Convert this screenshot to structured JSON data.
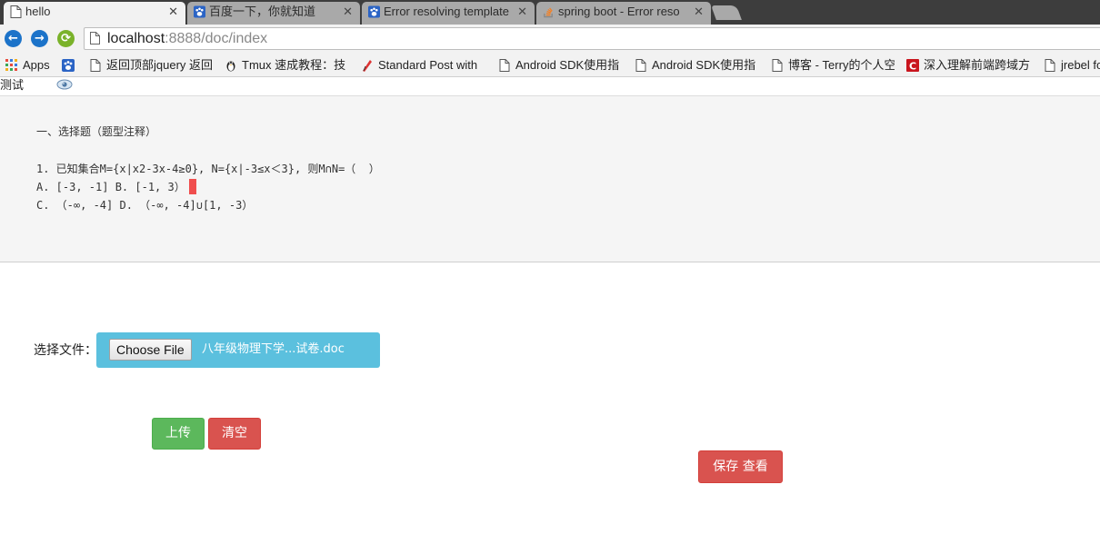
{
  "browser": {
    "tabs": [
      {
        "title": "hello",
        "favicon": "page-icon",
        "active": true
      },
      {
        "title": "百度一下，你就知道",
        "favicon": "baidu-paw-icon",
        "active": false
      },
      {
        "title": "Error resolving template",
        "favicon": "baidu-paw-icon",
        "active": false
      },
      {
        "title": "spring boot - Error reso",
        "favicon": "stackoverflow-icon",
        "active": false
      }
    ],
    "close_glyph": "✕",
    "url_host": "localhost",
    "url_rest": ":8888/doc/index",
    "bookmarks": [
      {
        "label": "Apps",
        "icon": "apps-grid-icon"
      },
      {
        "label": "",
        "icon": "baidu-paw-icon"
      },
      {
        "label": "返回顶部jquery 返回",
        "icon": "page-icon"
      },
      {
        "label": "Tmux 速成教程：技",
        "icon": "tux-icon"
      },
      {
        "label": "Standard Post with",
        "icon": "standard-post-icon"
      },
      {
        "label": "Android SDK使用指",
        "icon": "page-icon"
      },
      {
        "label": "Android SDK使用指",
        "icon": "page-icon"
      },
      {
        "label": "博客 - Terry的个人空",
        "icon": "page-icon"
      },
      {
        "label": "深入理解前端跨域方",
        "icon": "csdn-icon"
      },
      {
        "label": "jrebel fo",
        "icon": "page-icon"
      }
    ]
  },
  "page": {
    "nav_label": "测试",
    "doc": {
      "heading": "一、选择题（题型注释）",
      "question": "1. 已知集合M={x|x2-3x-4≥0}, N={x|-3≤x＜3}, 则M∩N=（  ）",
      "options_ab": "A. [-3, -1] B. [-1, 3）",
      "options_cd": "C. （-∞, -4] D. （-∞, -4]∪[1, -3）"
    },
    "file_label": "选择文件：",
    "choose_file_label": "Choose File",
    "file_name": "八年级物理下学...试卷.doc",
    "upload_label": "上传",
    "clear_label": "清空",
    "save_view_label": "保存 查看"
  },
  "colors": {
    "success": "#5cb85c",
    "danger": "#d9534f",
    "info": "#5bc0de",
    "cursor": "#f04e4e"
  }
}
